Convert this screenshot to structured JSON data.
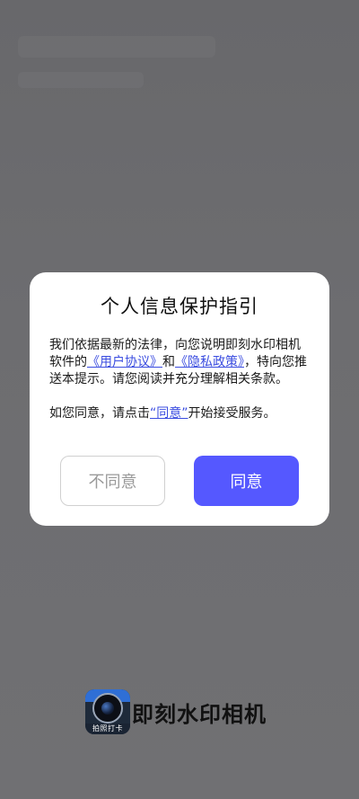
{
  "dialog": {
    "title": "个人信息保护指引",
    "body_intro": "我们依据最新的法律，向您说明即刻水印相机软件的",
    "user_agreement_link": "《用户协议》",
    "and_text": "和",
    "privacy_policy_link": "《隐私政策》",
    "body_rest": "，特向您推送本提示。请您阅读并充分理解相关条款。",
    "consent_prefix": "如您同意，请点击",
    "consent_link": "“同意”",
    "consent_suffix": "开始接受服务。",
    "disagree_label": "不同意",
    "agree_label": "同意"
  },
  "brand": {
    "icon_name": "camera-app-icon",
    "icon_tag": "拍照打卡",
    "app_name": "即刻水印相机"
  },
  "colors": {
    "overlay": "#6f6f72",
    "accent": "#5558ff",
    "link": "#3b4de0"
  }
}
